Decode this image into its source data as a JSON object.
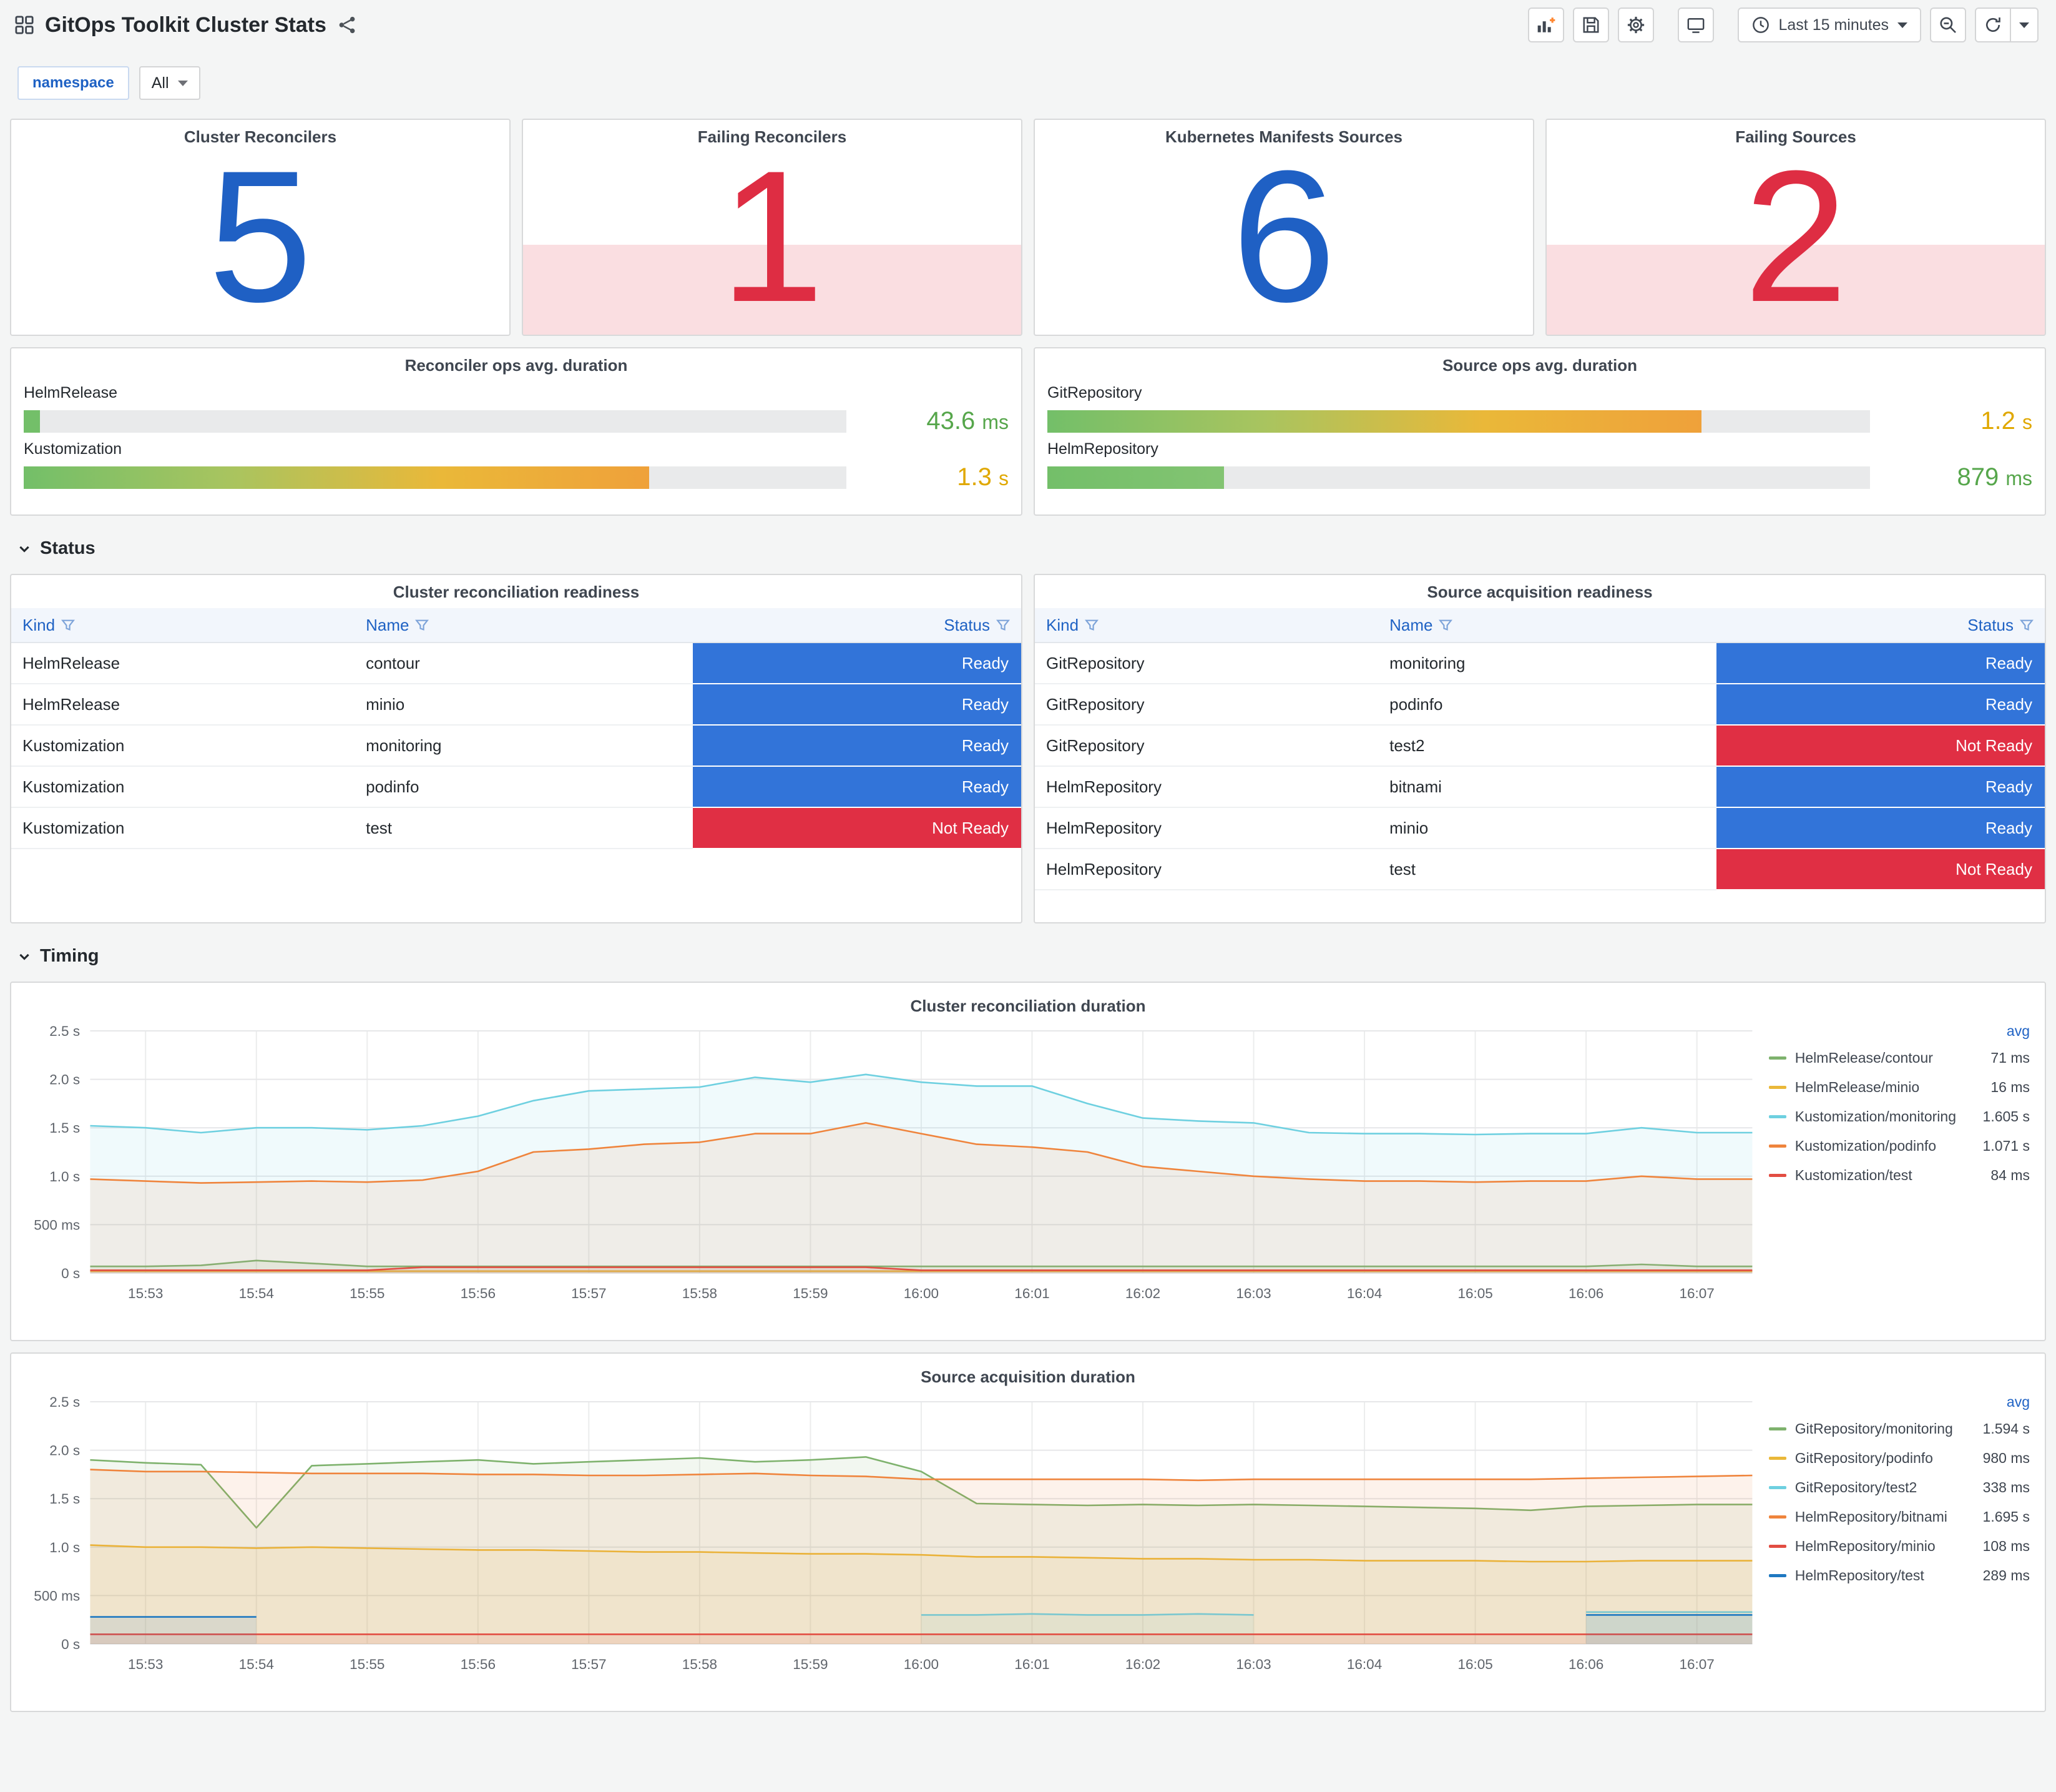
{
  "colors": {
    "stat_blue": "#1f60c4",
    "stat_red": "#de2d43",
    "ready": "#3274d9",
    "not_ready": "#e02f44",
    "link_blue": "#1f62c4",
    "green_text": "#56a64b",
    "yellow_text": "#e0a800"
  },
  "header": {
    "title": "GitOps Toolkit Cluster Stats",
    "time_range": "Last 15 minutes",
    "icons": [
      "dashboard-grid-icon",
      "share-icon",
      "add-panel-icon",
      "save-icon",
      "settings-gear-icon",
      "tv-mode-icon",
      "clock-icon",
      "caret-down-icon",
      "zoom-out-icon",
      "refresh-icon"
    ]
  },
  "filters": {
    "namespace_label": "namespace",
    "namespace_value": "All"
  },
  "sections": {
    "status": "Status",
    "timing": "Timing"
  },
  "stats": [
    {
      "title": "Cluster Reconcilers",
      "value": "5",
      "state": "ok"
    },
    {
      "title": "Failing Reconcilers",
      "value": "1",
      "state": "alert"
    },
    {
      "title": "Kubernetes Manifests Sources",
      "value": "6",
      "state": "ok"
    },
    {
      "title": "Failing Sources",
      "value": "2",
      "state": "alert"
    }
  ],
  "gauges": [
    {
      "title": "Reconciler ops avg. duration",
      "bars": [
        {
          "label": "HelmRelease",
          "value": "43.6",
          "unit": "ms",
          "pct": 2,
          "fill_colors": [
            "#73bf69",
            "#73bf69"
          ],
          "value_color": "#56a64b"
        },
        {
          "label": "Kustomization",
          "value": "1.3",
          "unit": "s",
          "pct": 76,
          "fill_colors": [
            "#73bf69",
            "#a9c45f",
            "#eab839",
            "#efa13a"
          ],
          "value_color": "#e0a800"
        }
      ]
    },
    {
      "title": "Source ops avg. duration",
      "bars": [
        {
          "label": "GitRepository",
          "value": "1.2",
          "unit": "s",
          "pct": 79.5,
          "fill_colors": [
            "#73bf69",
            "#a9c45f",
            "#eab839",
            "#efa13a"
          ],
          "value_color": "#e0a800"
        },
        {
          "label": "HelmRepository",
          "value": "879",
          "unit": "ms",
          "pct": 21.5,
          "fill_colors": [
            "#73bf69",
            "#83c472"
          ],
          "value_color": "#56a64b"
        }
      ]
    }
  ],
  "tables": [
    {
      "title": "Cluster reconciliation readiness",
      "columns": [
        "Kind",
        "Name",
        "Status"
      ],
      "rows": [
        {
          "kind": "HelmRelease",
          "name": "contour",
          "status": "Ready"
        },
        {
          "kind": "HelmRelease",
          "name": "minio",
          "status": "Ready"
        },
        {
          "kind": "Kustomization",
          "name": "monitoring",
          "status": "Ready"
        },
        {
          "kind": "Kustomization",
          "name": "podinfo",
          "status": "Ready"
        },
        {
          "kind": "Kustomization",
          "name": "test",
          "status": "Not Ready"
        }
      ]
    },
    {
      "title": "Source acquisition readiness",
      "columns": [
        "Kind",
        "Name",
        "Status"
      ],
      "rows": [
        {
          "kind": "GitRepository",
          "name": "monitoring",
          "status": "Ready"
        },
        {
          "kind": "GitRepository",
          "name": "podinfo",
          "status": "Ready"
        },
        {
          "kind": "GitRepository",
          "name": "test2",
          "status": "Not Ready"
        },
        {
          "kind": "HelmRepository",
          "name": "bitnami",
          "status": "Ready"
        },
        {
          "kind": "HelmRepository",
          "name": "minio",
          "status": "Ready"
        },
        {
          "kind": "HelmRepository",
          "name": "test",
          "status": "Not Ready"
        }
      ]
    }
  ],
  "chart_data": [
    {
      "type": "line",
      "title": "Cluster reconciliation duration",
      "ylim": [
        0,
        2.5
      ],
      "ymax": 2.5,
      "ylabels": [
        "0 s",
        "500 ms",
        "1.0 s",
        "1.5 s",
        "2.0 s",
        "2.5 s"
      ],
      "xlabels": [
        "15:53",
        "15:54",
        "15:55",
        "15:56",
        "15:57",
        "15:58",
        "15:59",
        "16:00",
        "16:01",
        "16:02",
        "16:03",
        "16:04",
        "16:05",
        "16:06",
        "16:07"
      ],
      "x_step_seconds": 30,
      "legend_header": "avg",
      "legend_position": "right",
      "grid": true,
      "series": [
        {
          "name": "HelmRelease/contour",
          "color": "#7eb26d",
          "avg": "71 ms",
          "values": [
            0.07,
            0.07,
            0.08,
            0.13,
            0.1,
            0.07,
            0.07,
            0.07,
            0.07,
            0.07,
            0.07,
            0.07,
            0.07,
            0.07,
            0.07,
            0.07,
            0.07,
            0.07,
            0.07,
            0.07,
            0.07,
            0.07,
            0.07,
            0.07,
            0.07,
            0.07,
            0.07,
            0.07,
            0.09,
            0.07,
            0.07
          ]
        },
        {
          "name": "HelmRelease/minio",
          "color": "#eab839",
          "avg": "16 ms",
          "values": [
            0.02,
            0.02,
            0.02,
            0.02,
            0.02,
            0.02,
            0.02,
            0.02,
            0.02,
            0.02,
            0.02,
            0.02,
            0.02,
            0.02,
            0.02,
            0.02,
            0.02,
            0.02,
            0.02,
            0.02,
            0.02,
            0.02,
            0.02,
            0.02,
            0.02,
            0.02,
            0.02,
            0.02,
            0.02,
            0.02,
            0.02
          ]
        },
        {
          "name": "Kustomization/monitoring",
          "color": "#6ed0e0",
          "avg": "1.605 s",
          "values": [
            1.52,
            1.5,
            1.45,
            1.5,
            1.5,
            1.48,
            1.52,
            1.62,
            1.78,
            1.88,
            1.9,
            1.92,
            2.02,
            1.97,
            2.05,
            1.97,
            1.93,
            1.93,
            1.75,
            1.6,
            1.57,
            1.55,
            1.45,
            1.44,
            1.44,
            1.43,
            1.44,
            1.44,
            1.5,
            1.45,
            1.45
          ]
        },
        {
          "name": "Kustomization/podinfo",
          "color": "#ef843c",
          "avg": "1.071 s",
          "values": [
            0.97,
            0.95,
            0.93,
            0.94,
            0.95,
            0.94,
            0.96,
            1.05,
            1.25,
            1.28,
            1.33,
            1.35,
            1.44,
            1.44,
            1.55,
            1.44,
            1.33,
            1.3,
            1.25,
            1.1,
            1.05,
            1.0,
            0.97,
            0.95,
            0.95,
            0.94,
            0.95,
            0.95,
            1.0,
            0.97,
            0.97
          ]
        },
        {
          "name": "Kustomization/test",
          "color": "#e24d42",
          "avg": "84 ms",
          "values": [
            0.03,
            0.03,
            0.03,
            0.03,
            0.03,
            0.03,
            0.06,
            0.06,
            0.06,
            0.06,
            0.06,
            0.06,
            0.06,
            0.06,
            0.06,
            0.03,
            0.03,
            0.03,
            0.03,
            0.03,
            0.03,
            0.03,
            0.03,
            0.03,
            0.03,
            0.03,
            0.03,
            0.03,
            0.03,
            0.03,
            0.03
          ]
        }
      ]
    },
    {
      "type": "line",
      "title": "Source acquisition duration",
      "ylim": [
        0,
        2.5
      ],
      "ymax": 2.5,
      "ylabels": [
        "0 s",
        "500 ms",
        "1.0 s",
        "1.5 s",
        "2.0 s",
        "2.5 s"
      ],
      "xlabels": [
        "15:53",
        "15:54",
        "15:55",
        "15:56",
        "15:57",
        "15:58",
        "15:59",
        "16:00",
        "16:01",
        "16:02",
        "16:03",
        "16:04",
        "16:05",
        "16:06",
        "16:07"
      ],
      "x_step_seconds": 30,
      "legend_header": "avg",
      "legend_position": "right",
      "grid": true,
      "series": [
        {
          "name": "GitRepository/monitoring",
          "color": "#7eb26d",
          "avg": "1.594 s",
          "values": [
            1.9,
            1.87,
            1.85,
            1.2,
            1.84,
            1.86,
            1.88,
            1.9,
            1.86,
            1.88,
            1.9,
            1.92,
            1.88,
            1.9,
            1.93,
            1.78,
            1.45,
            1.44,
            1.43,
            1.44,
            1.43,
            1.44,
            1.43,
            1.42,
            1.41,
            1.4,
            1.38,
            1.42,
            1.43,
            1.44,
            1.44
          ]
        },
        {
          "name": "GitRepository/podinfo",
          "color": "#eab839",
          "avg": "980 ms",
          "values": [
            1.02,
            1.0,
            1.0,
            0.99,
            1.0,
            0.99,
            0.98,
            0.97,
            0.97,
            0.96,
            0.95,
            0.95,
            0.94,
            0.93,
            0.93,
            0.92,
            0.9,
            0.9,
            0.89,
            0.88,
            0.88,
            0.87,
            0.87,
            0.86,
            0.86,
            0.86,
            0.85,
            0.85,
            0.86,
            0.86,
            0.86
          ]
        },
        {
          "name": "GitRepository/test2",
          "color": "#6ed0e0",
          "avg": "338 ms",
          "values": [
            null,
            null,
            null,
            null,
            null,
            null,
            null,
            null,
            null,
            null,
            null,
            null,
            null,
            null,
            null,
            0.3,
            0.3,
            0.31,
            0.3,
            0.3,
            0.31,
            0.3,
            null,
            null,
            null,
            null,
            null,
            0.33,
            0.33,
            0.33,
            0.33
          ]
        },
        {
          "name": "HelmRepository/bitnami",
          "color": "#ef843c",
          "avg": "1.695 s",
          "values": [
            1.8,
            1.78,
            1.78,
            1.77,
            1.76,
            1.76,
            1.76,
            1.75,
            1.75,
            1.74,
            1.74,
            1.75,
            1.76,
            1.74,
            1.73,
            1.7,
            1.7,
            1.7,
            1.7,
            1.7,
            1.69,
            1.7,
            1.7,
            1.7,
            1.7,
            1.7,
            1.7,
            1.71,
            1.72,
            1.73,
            1.74
          ]
        },
        {
          "name": "HelmRepository/minio",
          "color": "#e24d42",
          "avg": "108 ms",
          "values": [
            0.1,
            0.1,
            0.1,
            0.1,
            0.1,
            0.1,
            0.1,
            0.1,
            0.1,
            0.1,
            0.1,
            0.1,
            0.1,
            0.1,
            0.1,
            0.1,
            0.1,
            0.1,
            0.1,
            0.1,
            0.1,
            0.1,
            0.1,
            0.1,
            0.1,
            0.1,
            0.1,
            0.1,
            0.1,
            0.1,
            0.1
          ]
        },
        {
          "name": "HelmRepository/test",
          "color": "#1f78c1",
          "avg": "289 ms",
          "values": [
            0.28,
            0.28,
            0.28,
            0.28,
            null,
            null,
            null,
            null,
            null,
            null,
            null,
            null,
            null,
            null,
            null,
            null,
            null,
            null,
            null,
            null,
            null,
            null,
            null,
            null,
            null,
            null,
            null,
            0.3,
            0.3,
            0.3,
            0.3
          ]
        }
      ]
    }
  ]
}
